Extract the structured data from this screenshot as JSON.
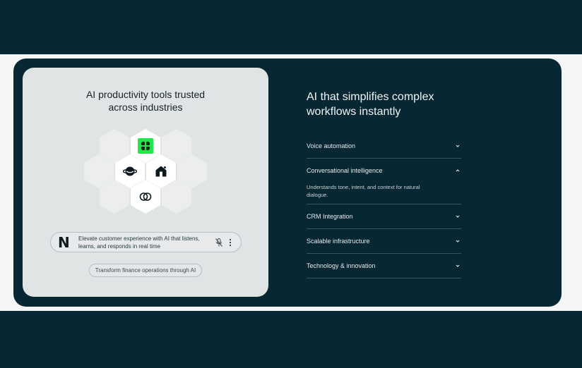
{
  "left_panel": {
    "title_line1": "AI productivity tools trusted",
    "title_line2": "across industries",
    "prompt": {
      "logo": "N",
      "text": "Elevate customer experience with AI that listens, learns, and responds in real time",
      "icons": [
        "mic-off-icon",
        "more-vertical-icon"
      ]
    },
    "suggestion": "Transform finance operations through AI"
  },
  "right_panel": {
    "heading_line1": "AI that simplifies complex",
    "heading_line2": "workflows instantly",
    "accordion": [
      {
        "label": "Voice automation",
        "open": false
      },
      {
        "label": "Conversational intelligence",
        "open": true,
        "description": "Understands tone, intent, and context for natural dialogue."
      },
      {
        "label": "CRM Integration",
        "open": false
      },
      {
        "label": "Scalable infrastructure",
        "open": false
      },
      {
        "label": "Technology & innovation",
        "open": false
      }
    ]
  },
  "colors": {
    "background": "#072732",
    "panel": "#e1e4e5",
    "accent_green": "#22e64a"
  }
}
